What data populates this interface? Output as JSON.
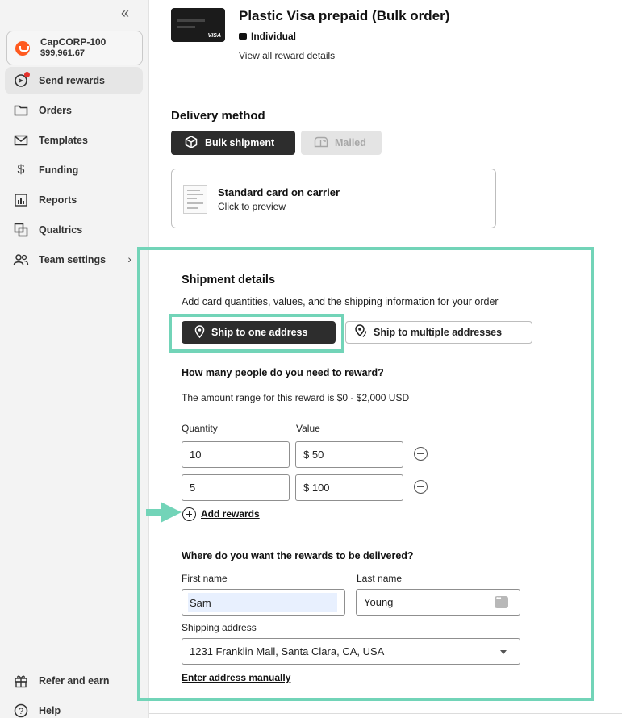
{
  "sidebar": {
    "collapse_glyph": "«",
    "account": {
      "name": "CapCORP-100",
      "balance": "$99,961.67"
    },
    "items": [
      {
        "label": "Send rewards",
        "icon": "send-icon",
        "active": true
      },
      {
        "label": "Orders",
        "icon": "folder-icon"
      },
      {
        "label": "Templates",
        "icon": "envelope-icon"
      },
      {
        "label": "Funding",
        "icon": "dollar-icon"
      },
      {
        "label": "Reports",
        "icon": "bar-chart-icon"
      },
      {
        "label": "Qualtrics",
        "icon": "qualtrics-icon"
      },
      {
        "label": "Team settings",
        "icon": "team-icon"
      }
    ],
    "bottom_items": [
      {
        "label": "Refer and earn",
        "icon": "gift-icon"
      },
      {
        "label": "Help",
        "icon": "help-icon"
      }
    ]
  },
  "product": {
    "card_brand": "VISA",
    "title": "Plastic Visa prepaid (Bulk order)",
    "type": "Individual",
    "view_details": "View all reward details"
  },
  "delivery": {
    "heading": "Delivery method",
    "bulk_label": "Bulk shipment",
    "mailed_label": "Mailed",
    "preview_title": "Standard card on carrier",
    "preview_sub": "Click to preview"
  },
  "shipment": {
    "heading": "Shipment details",
    "subtitle": "Add card quantities, values, and the shipping information for your order",
    "one_address": "Ship to one address",
    "multi_address": "Ship to multiple addresses",
    "how_many": "How many people do you need to reward?",
    "range": "The amount range for this reward is $0 - $2,000 USD",
    "quantity_label": "Quantity",
    "value_label": "Value",
    "rows": [
      {
        "quantity": "10",
        "value": "$ 50"
      },
      {
        "quantity": "5",
        "value": "$ 100"
      }
    ],
    "add_rewards": "Add rewards",
    "where": "Where do you want the rewards to be delivered?",
    "first_name_label": "First name",
    "first_name": "Sam",
    "last_name_label": "Last name",
    "last_name": "Young",
    "address_label": "Shipping address",
    "address": "1231 Franklin Mall, Santa Clara, CA, USA",
    "enter_manual": "Enter address manually"
  },
  "colors": {
    "highlight": "#72d4b8",
    "dark_button": "#2d2d2d",
    "brand": "#ff5a1f"
  }
}
